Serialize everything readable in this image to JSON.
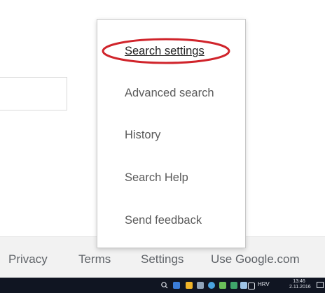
{
  "menu": {
    "items": [
      {
        "label": "Search settings"
      },
      {
        "label": "Advanced search"
      },
      {
        "label": "History"
      },
      {
        "label": "Search Help"
      },
      {
        "label": "Send feedback"
      }
    ]
  },
  "footer": {
    "links": [
      {
        "label": "Privacy"
      },
      {
        "label": "Terms"
      },
      {
        "label": "Settings"
      },
      {
        "label": "Use Google.com"
      }
    ]
  },
  "taskbar": {
    "language": "HRV",
    "time": "13:46",
    "date": "2.11.2016",
    "icons": [
      "search-icon",
      "task-view-icon",
      "file-explorer-icon",
      "store-icon",
      "chrome-icon",
      "chat-icon",
      "network-app-icon",
      "puzzle-icon",
      "network-icon",
      "volume-icon"
    ]
  },
  "colors": {
    "highlight": "#d0242b",
    "footer_bg": "#f2f2f2",
    "taskbar_bg": "#101522"
  }
}
